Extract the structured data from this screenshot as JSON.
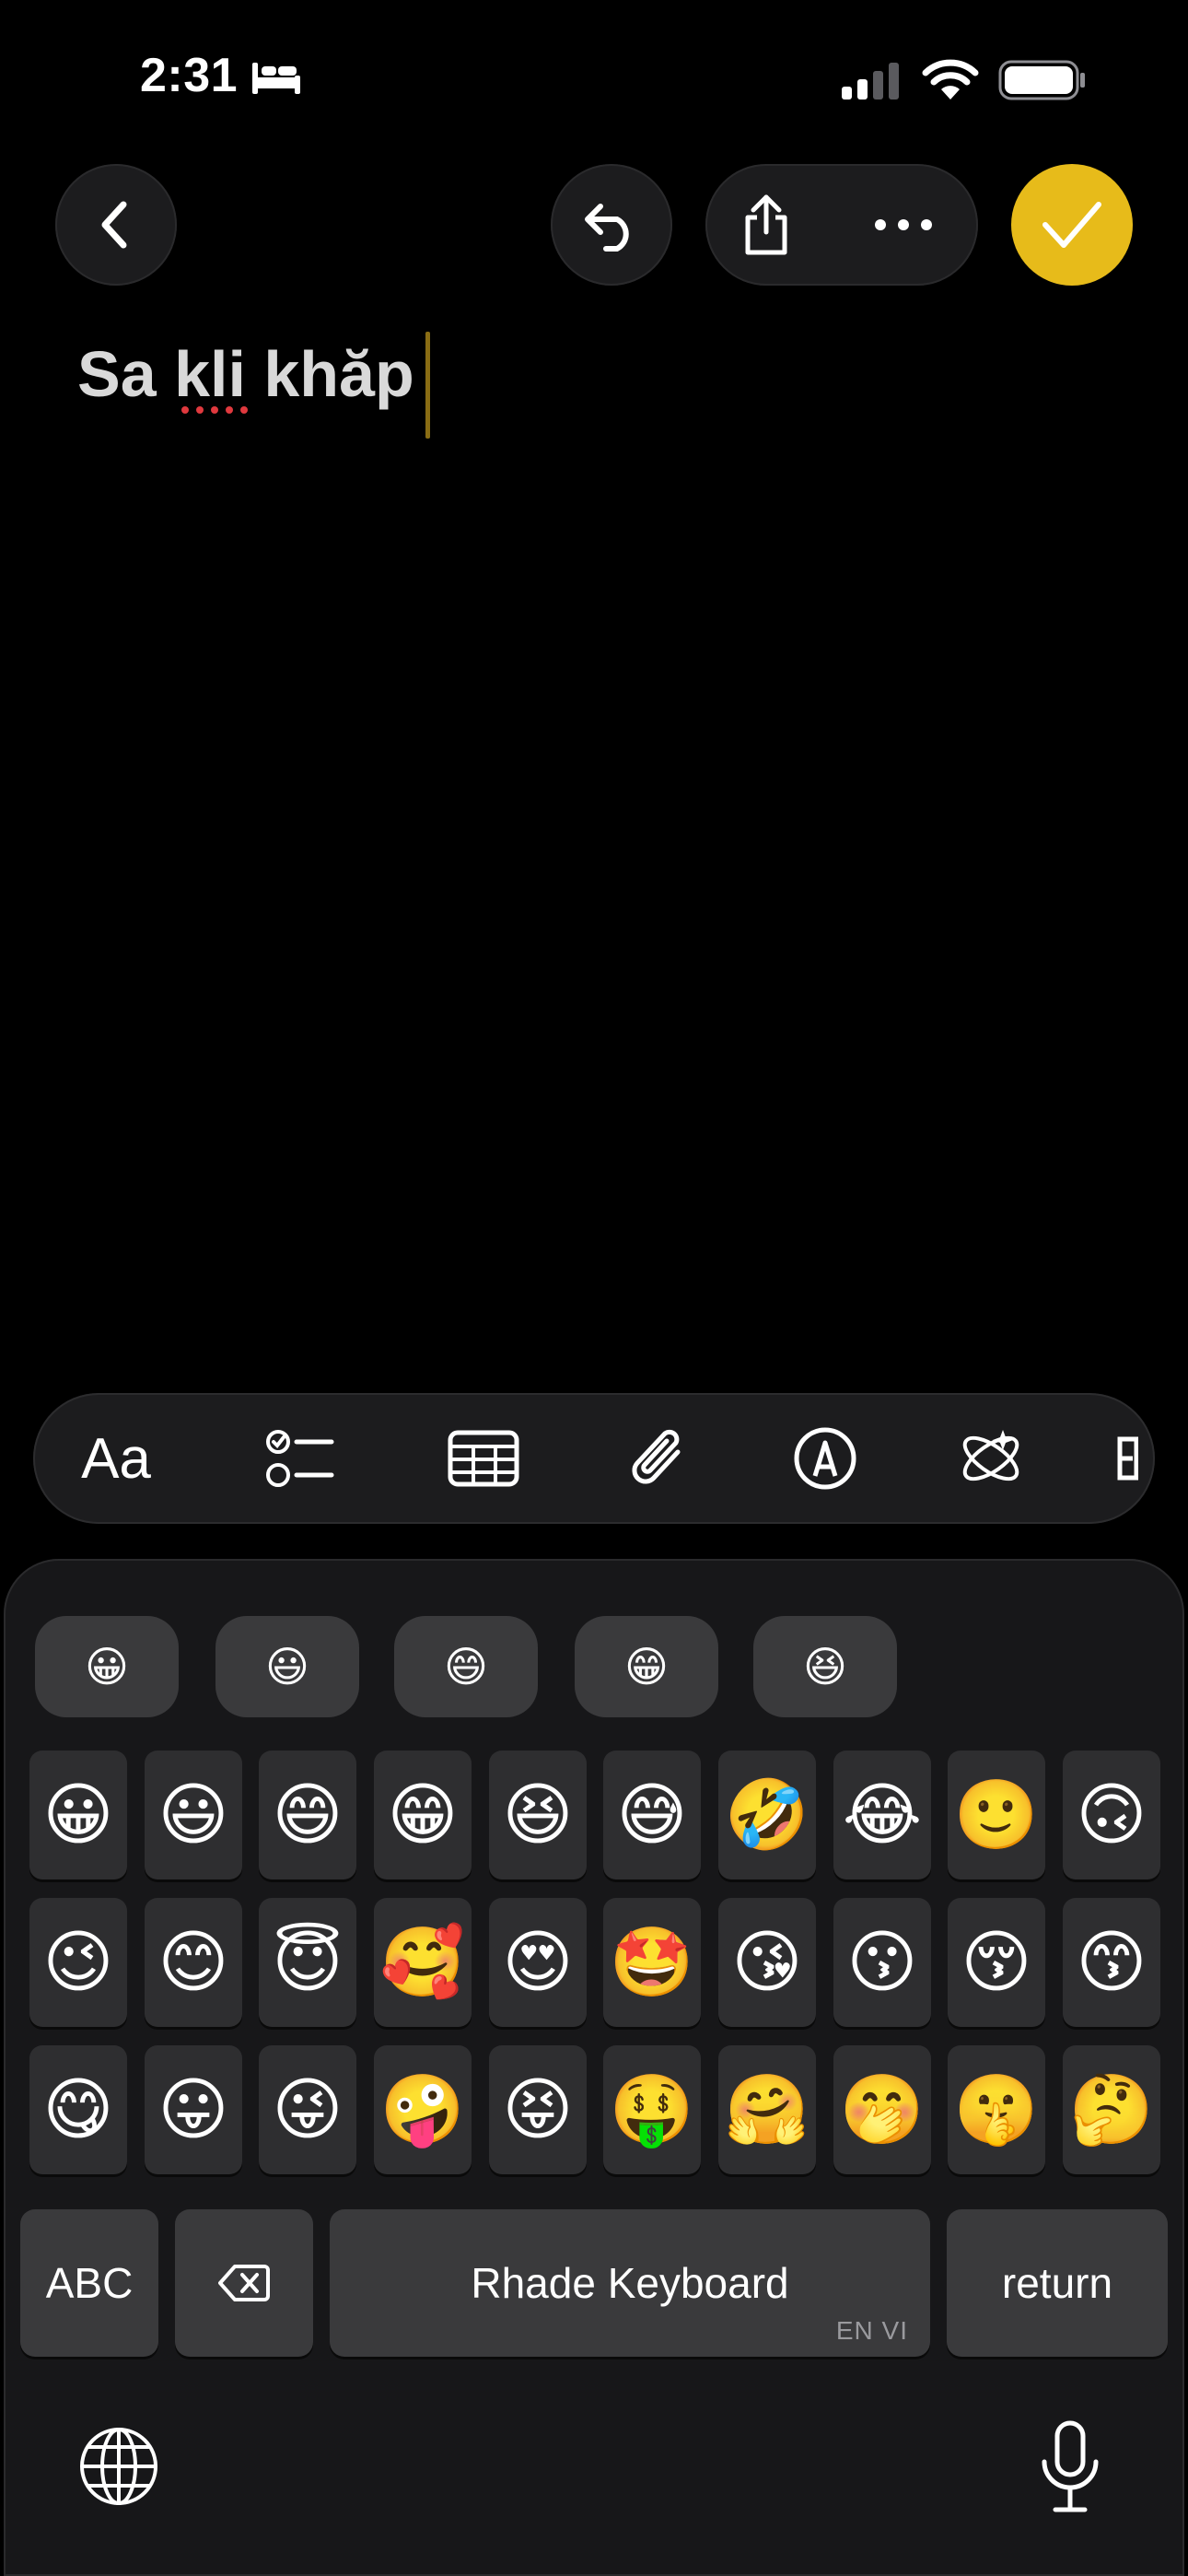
{
  "status_bar": {
    "time": "2:31"
  },
  "nav": {
    "back_icon": "chevron-left-icon",
    "undo_icon": "undo-icon",
    "share_icon": "share-icon",
    "more_icon": "ellipsis-icon",
    "done_icon": "checkmark-icon"
  },
  "note": {
    "text": "Sa kli khăp"
  },
  "toolbar": {
    "format_label": "Aa",
    "items": [
      "checklist-icon",
      "table-icon",
      "attachment-icon",
      "markup-icon",
      "writing-tools-icon"
    ]
  },
  "keyboard": {
    "recent_emoji": [
      "😀",
      "😃",
      "😄",
      "😁",
      "😆"
    ],
    "emoji_rows": [
      [
        "😀",
        "😃",
        "😄",
        "😁",
        "😆",
        "😅",
        "🤣",
        "😂",
        "🙂",
        "🙃"
      ],
      [
        "😉",
        "😊",
        "😇",
        "🥰",
        "😍",
        "🤩",
        "😘",
        "😗",
        "😚",
        "😙"
      ],
      [
        "😋",
        "😛",
        "😜",
        "🤪",
        "😝",
        "🤑",
        "🤗",
        "🤭",
        "🤫",
        "🤔"
      ]
    ],
    "abc_label": "ABC",
    "space_label": "Rhade Keyboard",
    "space_hint": "EN VI",
    "return_label": "return"
  },
  "colors": {
    "accent": "#e7bb1a",
    "background": "#000000",
    "keyboard_bg": "#171719"
  }
}
